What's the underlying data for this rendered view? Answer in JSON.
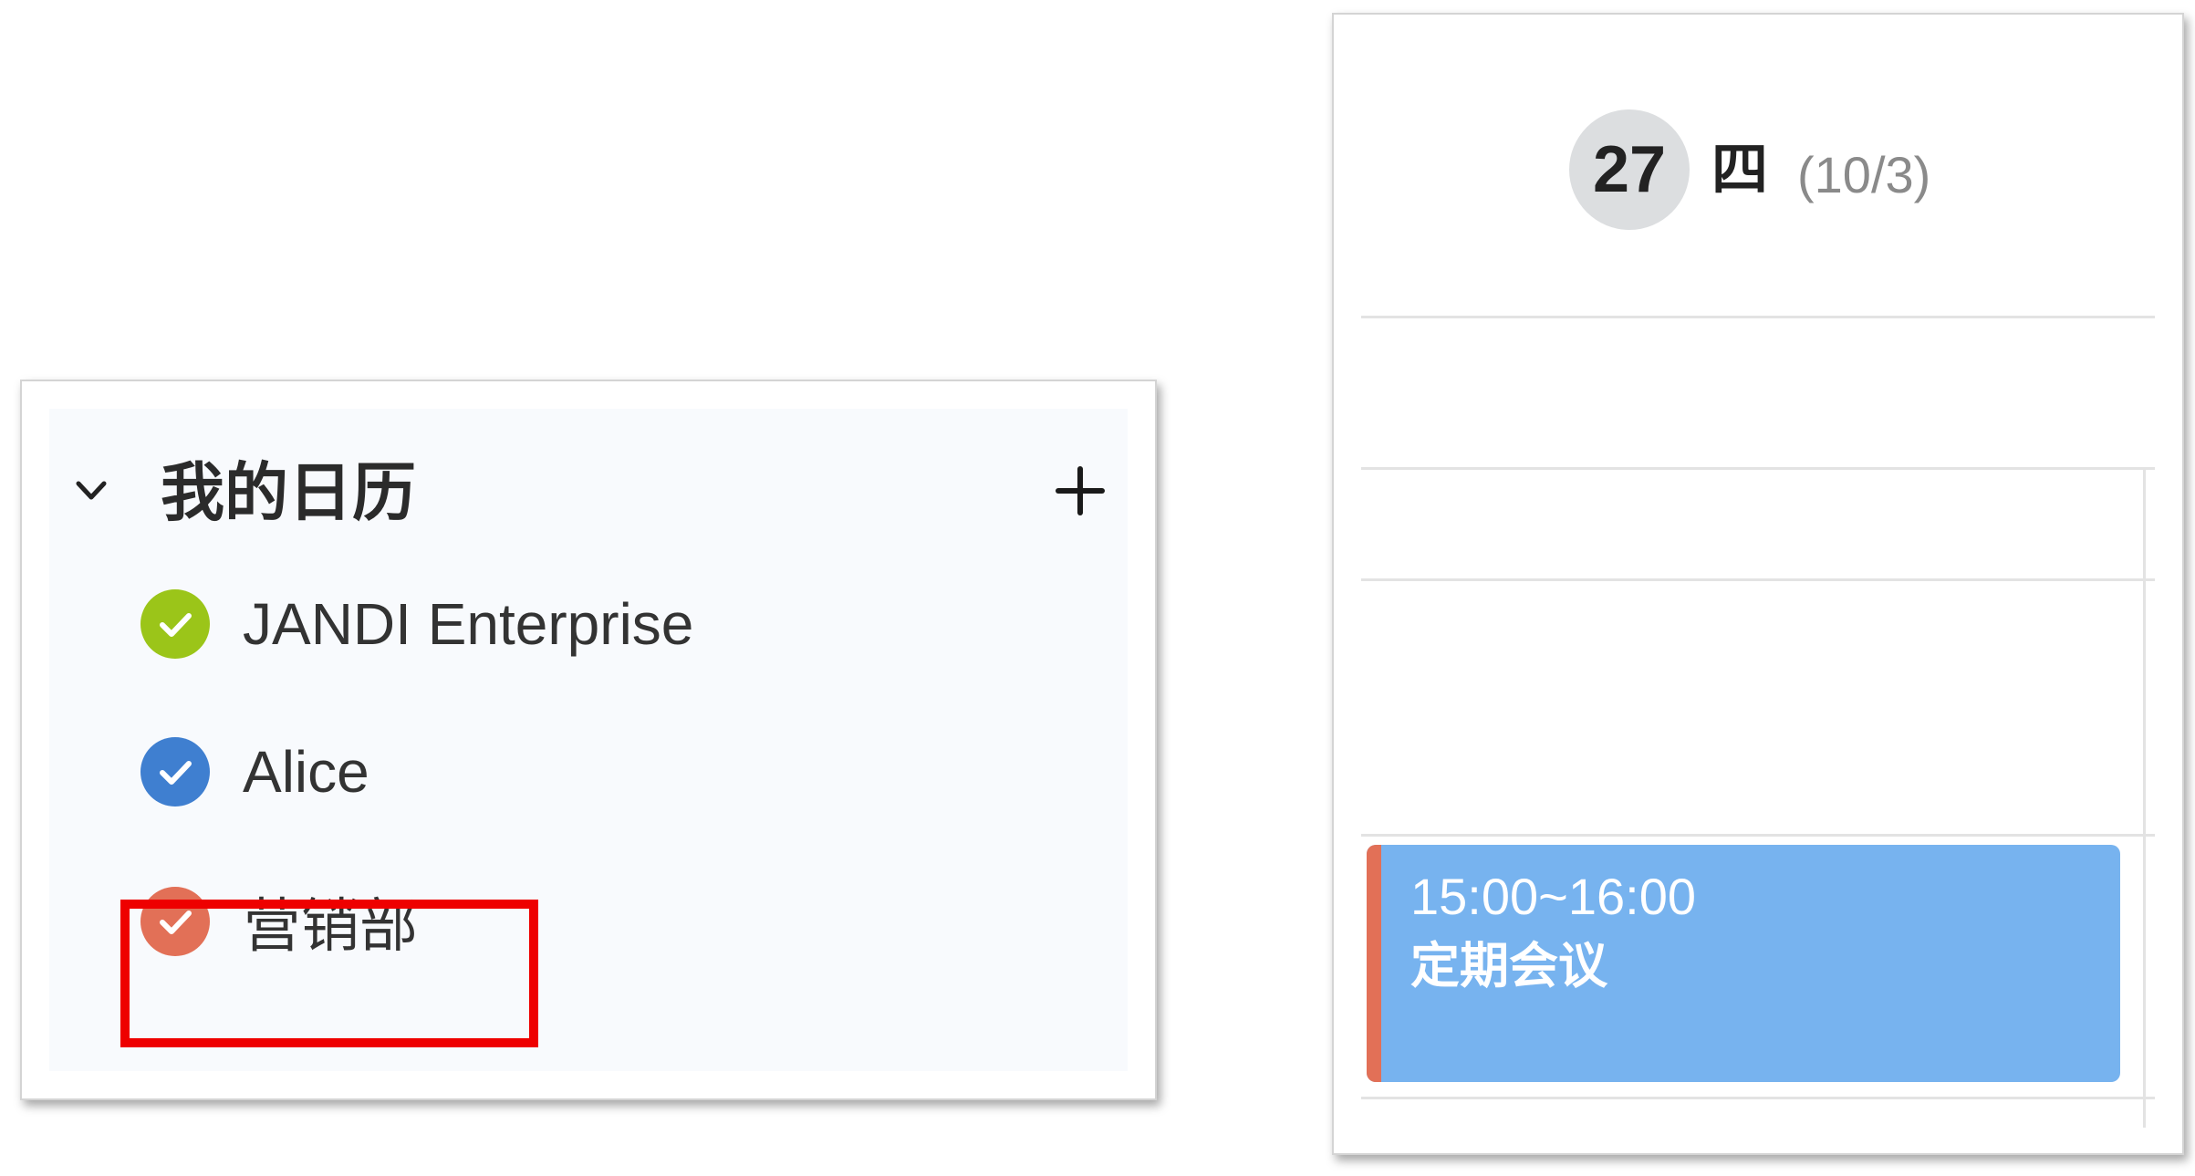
{
  "calendar_panel": {
    "title": "我的日历",
    "toggle_icon": "chevron-down-icon",
    "add_icon": "plus-icon",
    "items": [
      {
        "label": "JANDI Enterprise",
        "color": "#9bc519",
        "checked": true,
        "icon": "check-circle-icon"
      },
      {
        "label": "Alice",
        "color": "#3f7fd0",
        "checked": true,
        "icon": "check-circle-icon"
      },
      {
        "label": "营销部",
        "color": "#e27057",
        "checked": true,
        "icon": "check-circle-icon"
      }
    ],
    "highlight_color": "#ee0000"
  },
  "day_view": {
    "date_number": "27",
    "weekday": "四",
    "lunar_date": "(10/3)",
    "event": {
      "time": "15:00~16:00",
      "title": "定期会议",
      "color": "#77b3ef",
      "calendar_color": "#e27057"
    }
  }
}
